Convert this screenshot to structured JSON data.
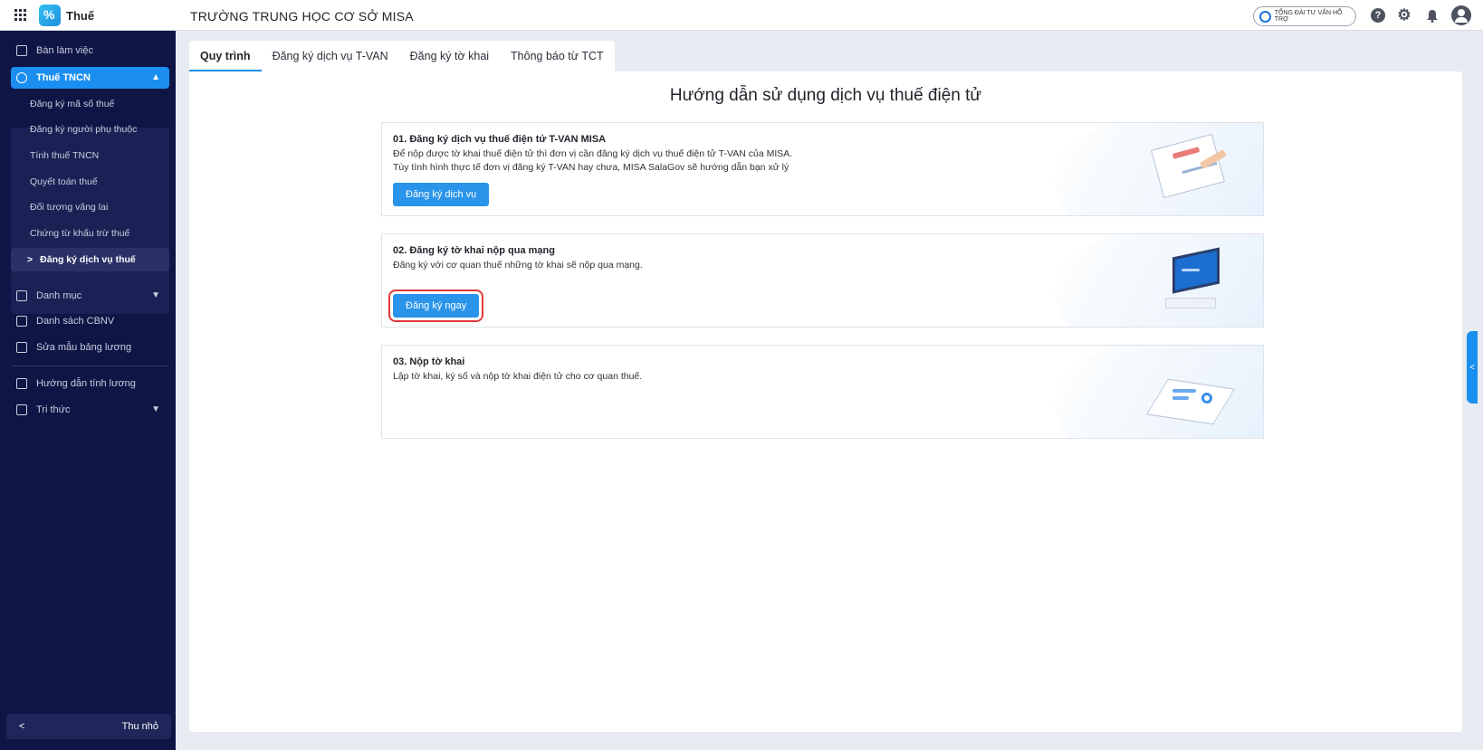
{
  "header": {
    "app_name": "Thuế",
    "org_name": "TRƯỜNG TRUNG HỌC CƠ SỞ MISA",
    "support_label": "TỔNG ĐÀI TƯ VẤN HỖ TRỢ"
  },
  "sidebar": {
    "items": [
      {
        "label": "Bàn làm việc"
      },
      {
        "label": "Thuế TNCN"
      }
    ],
    "sub_items": [
      {
        "label": "Đăng ký mã số thuế"
      },
      {
        "label": "Đăng ký người phụ thuộc"
      },
      {
        "label": "Tính thuế TNCN"
      },
      {
        "label": "Quyết toán thuế"
      },
      {
        "label": "Đối tượng vãng lai"
      },
      {
        "label": "Chứng từ khấu trừ thuế"
      },
      {
        "label": "Đăng ký dịch vụ thuế"
      }
    ],
    "lower_items": [
      {
        "label": "Danh mục"
      },
      {
        "label": "Danh sách CBNV"
      },
      {
        "label": "Sửa mẫu bảng lương"
      },
      {
        "label": "Hướng dẫn tính lương"
      },
      {
        "label": "Tri thức"
      }
    ],
    "collapse_label": "Thu nhỏ"
  },
  "tabs": [
    {
      "label": "Quy trình"
    },
    {
      "label": "Đăng ký dịch vụ T-VAN"
    },
    {
      "label": "Đăng ký tờ khai"
    },
    {
      "label": "Thông báo từ TCT"
    }
  ],
  "main": {
    "title": "Hướng dẫn sử dụng dịch vụ thuế điện tử",
    "cards": [
      {
        "title": "01. Đăng ký dịch vụ thuế điện tử T-VAN MISA",
        "desc1": "Để nộp được tờ khai thuế điện tử thì đơn vị cần đăng ký dịch vụ thuế điện tử T-VAN của MISA.",
        "desc2": "Tùy tình hình thực tế đơn vị đăng ký T-VAN hay chưa, MISA SalaGov sẽ hướng dẫn bạn xử lý",
        "button": "Đăng ký dịch vụ"
      },
      {
        "title": "02. Đăng ký tờ khai nộp qua mạng",
        "desc1": "Đăng ký với cơ quan thuế những tờ khai sẽ nộp qua mạng.",
        "button": "Đăng ký ngay"
      },
      {
        "title": "03. Nộp tờ khai",
        "desc1": "Lập tờ khai, ký số và nộp tờ khai điện tử cho cơ quan thuế."
      }
    ]
  },
  "colors": {
    "sidebar_bg": "#0f1646",
    "accent": "#1b8ff0",
    "highlight_border": "#e03a3a"
  }
}
